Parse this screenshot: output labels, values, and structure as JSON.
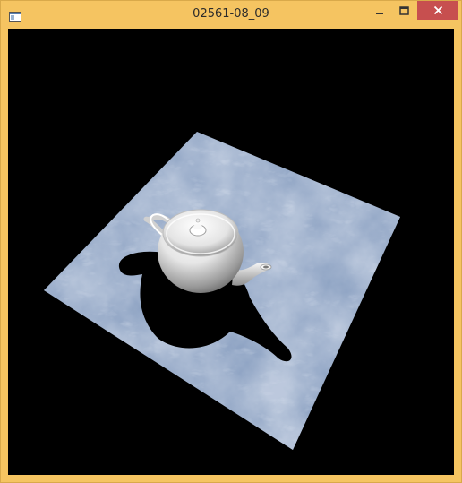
{
  "window": {
    "title": "02561-08_09",
    "frame_color": "#f5c461",
    "close_color": "#c74f4f"
  },
  "icons": {
    "app": "app-window-icon",
    "minimize": "minimize-icon",
    "maximize": "maximize-icon",
    "close": "close-icon"
  },
  "scene": {
    "background": "#000000",
    "ground_texture": "marble",
    "ground_color": "#8ea3c3",
    "object": "teapot",
    "object_color": "#f2f2f2",
    "shadow_color": "#000000"
  }
}
